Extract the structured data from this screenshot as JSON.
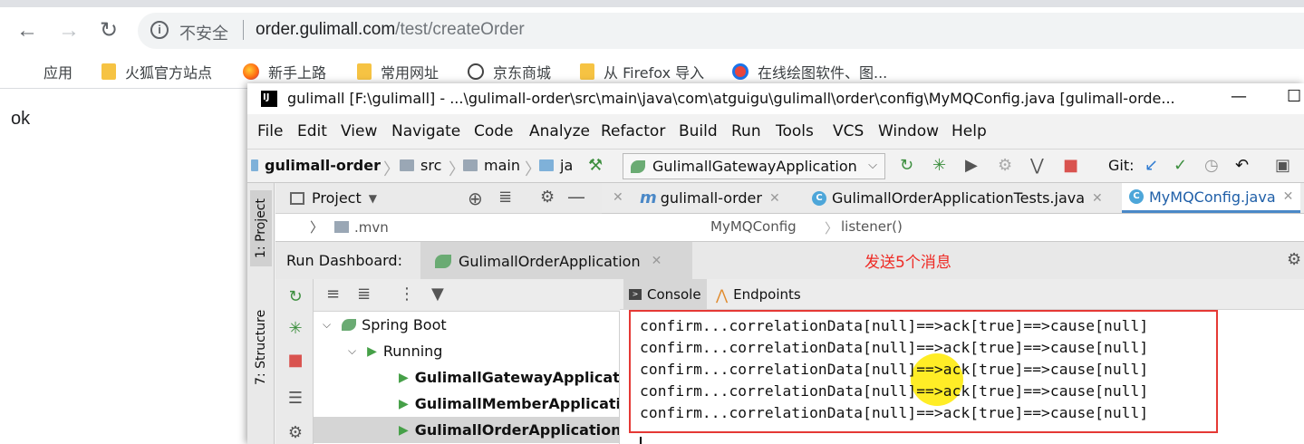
{
  "browser": {
    "nav": {
      "back_icon": "back-arrow-icon",
      "forward_icon": "forward-arrow-icon",
      "reload_icon": "reload-icon"
    },
    "omnibox": {
      "security_label": "不安全",
      "url_host": "order.gulimall.com",
      "url_path": "/test/createOrder"
    },
    "bookmarks": [
      {
        "label": "应用",
        "icon": "apps-grid-icon"
      },
      {
        "label": "火狐官方站点",
        "icon": "folder-icon"
      },
      {
        "label": "新手上路",
        "icon": "firefox-icon"
      },
      {
        "label": "常用网址",
        "icon": "folder-icon"
      },
      {
        "label": "京东商城",
        "icon": "globe-icon"
      },
      {
        "label": "从 Firefox 导入",
        "icon": "folder-icon"
      },
      {
        "label": "在线绘图软件、图...",
        "icon": "drawio-icon"
      }
    ],
    "page_text": "ok"
  },
  "ide": {
    "title": "gulimall [F:\\gulimall] - ...\\gulimall-order\\src\\main\\java\\com\\atguigu\\gulimall\\order\\config\\MyMQConfig.java [gulimall-orde...",
    "window_controls": {
      "minimize": "—",
      "maximize": "☐"
    },
    "menu": [
      "File",
      "Edit",
      "View",
      "Navigate",
      "Code",
      "Analyze",
      "Refactor",
      "Build",
      "Run",
      "Tools",
      "VCS",
      "Window",
      "Help"
    ],
    "breadcrumbs": {
      "module": "gulimall-order",
      "src": "src",
      "main": "main",
      "java": "ja"
    },
    "run_config": "GulimallGatewayApplication",
    "git_label": "Git:",
    "left_strip": {
      "project_tab": "1: Project",
      "structure_tab": "7: Structure"
    },
    "project_panel": {
      "title": "Project",
      "tree_item": ".mvn"
    },
    "editor_tabs": [
      {
        "label": "gulimall-order",
        "icon": "maven-module-icon",
        "active": false
      },
      {
        "label": "GulimallOrderApplicationTests.java",
        "icon": "class-icon",
        "active": false
      },
      {
        "label": "MyMQConfig.java",
        "icon": "class-icon",
        "active": true
      }
    ],
    "editor_breadcrumbs": {
      "class": "MyMQConfig",
      "method": "listener()"
    },
    "run_dashboard": {
      "label": "Run Dashboard:",
      "tab_label": "GulimallOrderApplication",
      "annotation": "发送5个消息",
      "tree": {
        "spring_boot": "Spring Boot",
        "running": "Running",
        "apps": [
          "GulimallGatewayApplicatio",
          "GulimallMemberApplicatio",
          "GulimallOrderApplication"
        ]
      },
      "console_tabs": {
        "console": "Console",
        "endpoints": "Endpoints"
      },
      "console_lines": [
        "confirm...correlationData[null]==>ack[true]==>cause[null]",
        "confirm...correlationData[null]==>ack[true]==>cause[null]",
        "confirm...correlationData[null]==>ack[true]==>cause[null]",
        "confirm...correlationData[null]==>ack[true]==>cause[null]",
        "confirm...correlationData[null]==>ack[true]==>cause[null]"
      ]
    }
  },
  "colors": {
    "annotation_red": "#ee2a24",
    "spring_green": "#6aab73",
    "tab_blue": "#4a88c7",
    "cursor_yellow": "#ffea00"
  }
}
